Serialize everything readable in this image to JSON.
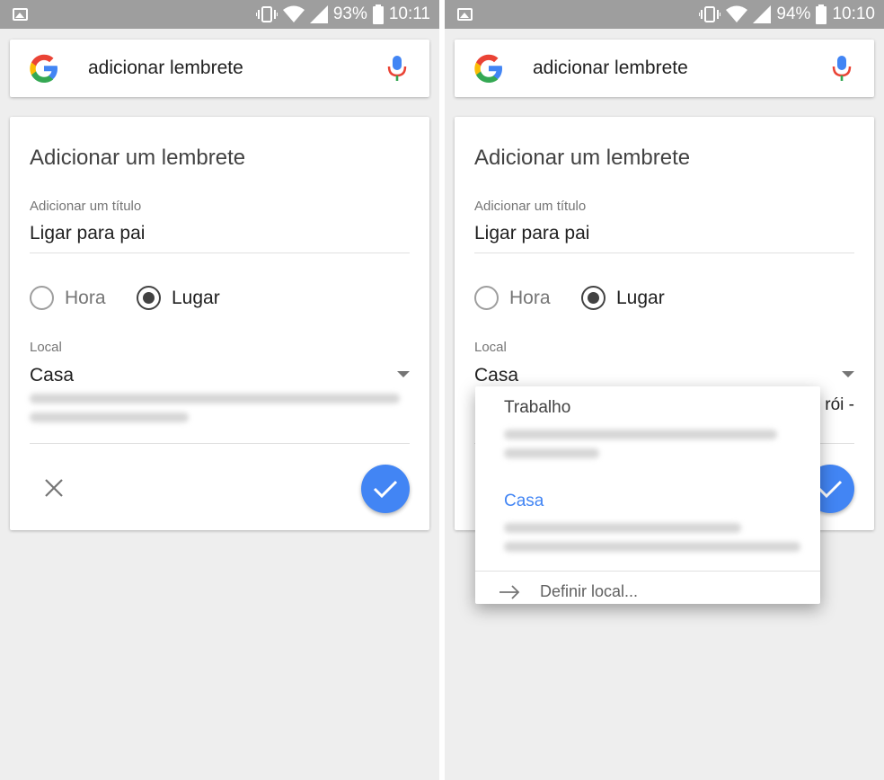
{
  "left": {
    "status": {
      "battery": "93%",
      "time": "10:11"
    },
    "search": {
      "query": "adicionar lembrete"
    },
    "card": {
      "title": "Adicionar um lembrete",
      "title_field_label": "Adicionar um título",
      "title_field_value": "Ligar para pai",
      "radio_time": "Hora",
      "radio_place": "Lugar",
      "selected": "Lugar",
      "location_label": "Local",
      "location_value": "Casa"
    }
  },
  "right": {
    "status": {
      "battery": "94%",
      "time": "10:10"
    },
    "search": {
      "query": "adicionar lembrete"
    },
    "card": {
      "title": "Adicionar um lembrete",
      "title_field_label": "Adicionar um título",
      "title_field_value": "Ligar para pai",
      "radio_time": "Hora",
      "radio_place": "Lugar",
      "selected": "Lugar",
      "location_label": "Local",
      "location_value": "Casa",
      "partial_text": "rói -"
    },
    "menu": {
      "option_work": "Trabalho",
      "option_home": "Casa",
      "define_location": "Definir local..."
    }
  },
  "colors": {
    "accent": "#4285f4",
    "statusbar": "#9e9e9e",
    "background": "#eeeeee"
  },
  "icons": [
    "image-icon",
    "vibrate-icon",
    "wifi-icon",
    "signal-icon",
    "battery-icon",
    "google-logo",
    "mic-icon",
    "close-icon",
    "check-icon",
    "arrow-right-icon",
    "dropdown-arrow-icon"
  ]
}
